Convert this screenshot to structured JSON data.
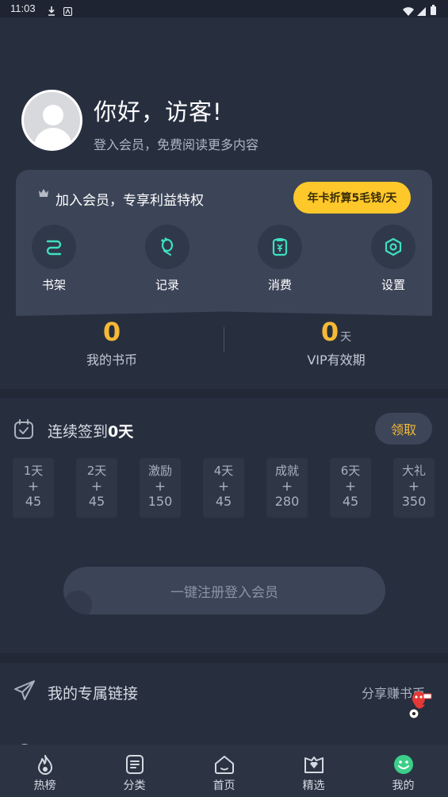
{
  "status_bar": {
    "time": "11:03",
    "icons": [
      "download-icon",
      "notification-icon",
      "wifi-icon",
      "signal-icon",
      "battery-icon"
    ]
  },
  "profile": {
    "avatar_icon": "default-avatar-icon",
    "greeting": "你好，访客!",
    "subtitle": "登入会员，免费阅读更多内容"
  },
  "member_card": {
    "crown_icon": "crown-icon",
    "title": "加入会员，专享利益特权",
    "promo_button": "年卡折算5毛钱/天",
    "actions": [
      {
        "label": "书架",
        "icon": "bookshelf-icon"
      },
      {
        "label": "记录",
        "icon": "footprint-icon"
      },
      {
        "label": "消费",
        "icon": "payment-icon"
      },
      {
        "label": "设置",
        "icon": "settings-icon"
      }
    ]
  },
  "stats": {
    "coins": {
      "value": "0",
      "label": "我的书币"
    },
    "vip": {
      "value": "0",
      "unit": "天",
      "label": "VIP有效期"
    }
  },
  "signin": {
    "title_prefix": "连续签到",
    "days_count": "0天",
    "claim_button": "领取",
    "days": [
      {
        "name": "1天",
        "plus": "+",
        "value": "45"
      },
      {
        "name": "2天",
        "plus": "+",
        "value": "45"
      },
      {
        "name": "激励",
        "plus": "+",
        "value": "150"
      },
      {
        "name": "4天",
        "plus": "+",
        "value": "45"
      },
      {
        "name": "成就",
        "plus": "+",
        "value": "280"
      },
      {
        "name": "6天",
        "plus": "+",
        "value": "45"
      },
      {
        "name": "大礼",
        "plus": "+",
        "value": "350"
      }
    ]
  },
  "register_button": "一键注册登入会员",
  "exclusive_link": {
    "title": "我的专属链接",
    "action": "分享赚书币"
  },
  "tabbar": {
    "items": [
      {
        "label": "热榜",
        "icon": "flame-icon"
      },
      {
        "label": "分类",
        "icon": "category-icon"
      },
      {
        "label": "首页",
        "icon": "home-icon"
      },
      {
        "label": "精选",
        "icon": "featured-icon"
      },
      {
        "label": "我的",
        "icon": "profile-smile-icon"
      }
    ],
    "active_color": "#3ccf8a"
  },
  "colors": {
    "background": "#272f3f",
    "card": "#3c4558",
    "accent_gold": "#f6b935",
    "promo_yellow": "#ffc82a",
    "icon_teal": "#3de0c2"
  }
}
